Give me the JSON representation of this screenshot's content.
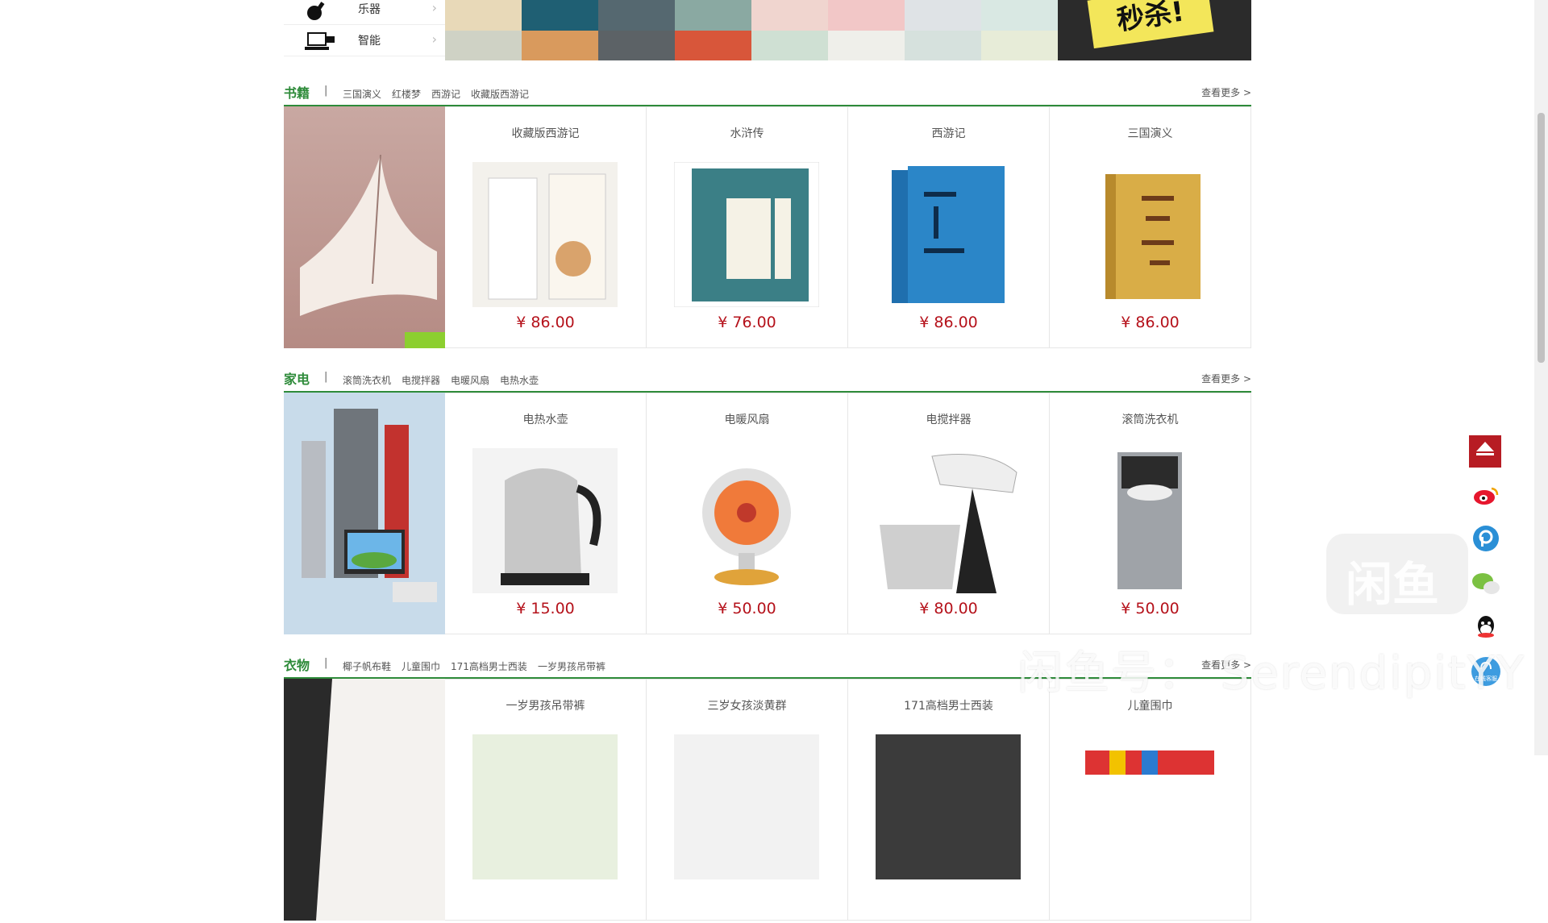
{
  "categories": [
    {
      "label": "乐器",
      "icon": "guitar-icon"
    },
    {
      "label": "智能",
      "icon": "computer-icon"
    }
  ],
  "promo_banner_text": "秒杀!",
  "sections": [
    {
      "title": "书籍",
      "tags": [
        "三国演义",
        "红楼梦",
        "西游记",
        "收藏版西游记"
      ],
      "more": "查看更多 >",
      "products": [
        {
          "name": "收藏版西游记",
          "price": "¥ 86.00"
        },
        {
          "name": "水浒传",
          "price": "¥ 76.00"
        },
        {
          "name": "西游记",
          "price": "¥ 86.00"
        },
        {
          "name": "三国演义",
          "price": "¥ 86.00"
        }
      ]
    },
    {
      "title": "家电",
      "tags": [
        "滚筒洗衣机",
        "电搅拌器",
        "电暖风扇",
        "电热水壶"
      ],
      "more": "查看更多 >",
      "products": [
        {
          "name": "电热水壶",
          "price": "¥ 15.00"
        },
        {
          "name": "电暖风扇",
          "price": "¥ 50.00"
        },
        {
          "name": "电搅拌器",
          "price": "¥ 80.00"
        },
        {
          "name": "滚筒洗衣机",
          "price": "¥ 50.00"
        }
      ]
    },
    {
      "title": "衣物",
      "tags": [
        "椰子帆布鞋",
        "儿童围巾",
        "171高档男士西装",
        "一岁男孩吊带裤"
      ],
      "more": "查看更多 >",
      "products": [
        {
          "name": "一岁男孩吊带裤",
          "price": ""
        },
        {
          "name": "三岁女孩淡黄群",
          "price": ""
        },
        {
          "name": "171高档男士西装",
          "price": ""
        },
        {
          "name": "儿童围巾",
          "price": ""
        }
      ]
    }
  ],
  "float_bar": {
    "icons": [
      "back-to-top-icon",
      "weibo-icon",
      "pinterest-icon",
      "wechat-icon",
      "qq-icon",
      "online-service-icon"
    ],
    "service_label": "在线客服"
  },
  "watermark": {
    "logo_text": "闲鱼",
    "text": "闲鱼号： SerendipitYY"
  },
  "colors": {
    "accent_green": "#2e8b3a",
    "price_red": "#b5121b",
    "top_button_red": "#b71c23"
  }
}
